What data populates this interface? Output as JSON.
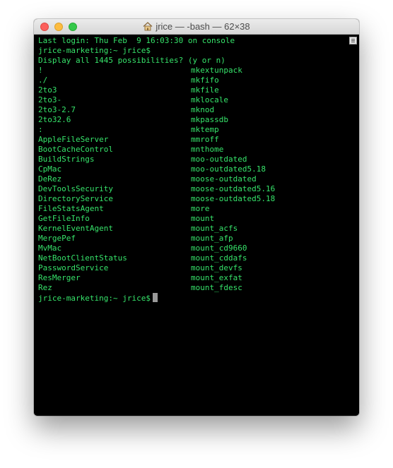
{
  "window": {
    "title": "jrice — -bash — 62×38"
  },
  "terminal": {
    "intro_lines": [
      "Last login: Thu Feb  9 16:03:30 on console",
      "jrice-marketing:~ jrice$",
      "Display all 1445 possibilities? (y or n)"
    ],
    "completions": [
      [
        "!",
        "mkextunpack"
      ],
      [
        "./",
        "mkfifo"
      ],
      [
        "2to3",
        "mkfile"
      ],
      [
        "2to3-",
        "mklocale"
      ],
      [
        "2to3-2.7",
        "mknod"
      ],
      [
        "2to32.6",
        "mkpassdb"
      ],
      [
        ":",
        "mktemp"
      ],
      [
        "AppleFileServer",
        "mmroff"
      ],
      [
        "BootCacheControl",
        "mnthome"
      ],
      [
        "BuildStrings",
        "moo-outdated"
      ],
      [
        "CpMac",
        "moo-outdated5.18"
      ],
      [
        "DeRez",
        "moose-outdated"
      ],
      [
        "DevToolsSecurity",
        "moose-outdated5.16"
      ],
      [
        "DirectoryService",
        "moose-outdated5.18"
      ],
      [
        "FileStatsAgent",
        "more"
      ],
      [
        "GetFileInfo",
        "mount"
      ],
      [
        "KernelEventAgent",
        "mount_acfs"
      ],
      [
        "MergePef",
        "mount_afp"
      ],
      [
        "MvMac",
        "mount_cd9660"
      ],
      [
        "NetBootClientStatus",
        "mount_cddafs"
      ],
      [
        "PasswordService",
        "mount_devfs"
      ],
      [
        "ResMerger",
        "mount_exfat"
      ],
      [
        "Rez",
        "mount_fdesc"
      ]
    ],
    "prompt": "jrice-marketing:~ jrice$"
  },
  "colors": {
    "text": "#36e36a",
    "background": "#000000",
    "cursor": "#9a9a9a"
  },
  "icons": {
    "title_icon": "home-icon",
    "scroll_icon": "scrollbar-menu-icon"
  }
}
